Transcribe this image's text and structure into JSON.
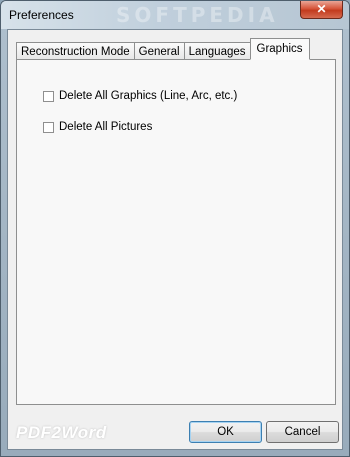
{
  "window": {
    "title": "Preferences",
    "close_symbol": "✕",
    "watermark": "SOFTPEDIA"
  },
  "tabs": [
    {
      "label": "Reconstruction Mode",
      "active": false
    },
    {
      "label": "General",
      "active": false
    },
    {
      "label": "Languages",
      "active": false
    },
    {
      "label": "Graphics",
      "active": true
    }
  ],
  "options": {
    "delete_graphics": {
      "label": "Delete All Graphics (Line, Arc, etc.)",
      "checked": false
    },
    "delete_pictures": {
      "label": "Delete All Pictures",
      "checked": false
    }
  },
  "footer": {
    "logo": "PDF2Word"
  },
  "buttons": {
    "ok": "OK",
    "cancel": "Cancel"
  }
}
